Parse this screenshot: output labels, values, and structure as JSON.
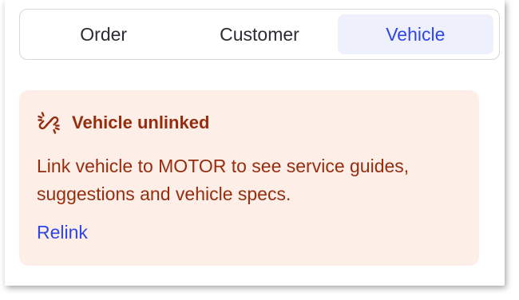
{
  "tabs": [
    {
      "label": "Order",
      "active": false
    },
    {
      "label": "Customer",
      "active": false
    },
    {
      "label": "Vehicle",
      "active": true
    }
  ],
  "alert": {
    "icon": "unlink-icon",
    "title": "Vehicle unlinked",
    "message": "Link vehicle to MOTOR to see service guides, suggestions and vehicle specs.",
    "action_label": "Relink"
  },
  "colors": {
    "accent": "#2f46e6",
    "alert_bg": "#fdeee7",
    "alert_text": "#962d0e",
    "active_tab_bg": "#eef0fb"
  }
}
